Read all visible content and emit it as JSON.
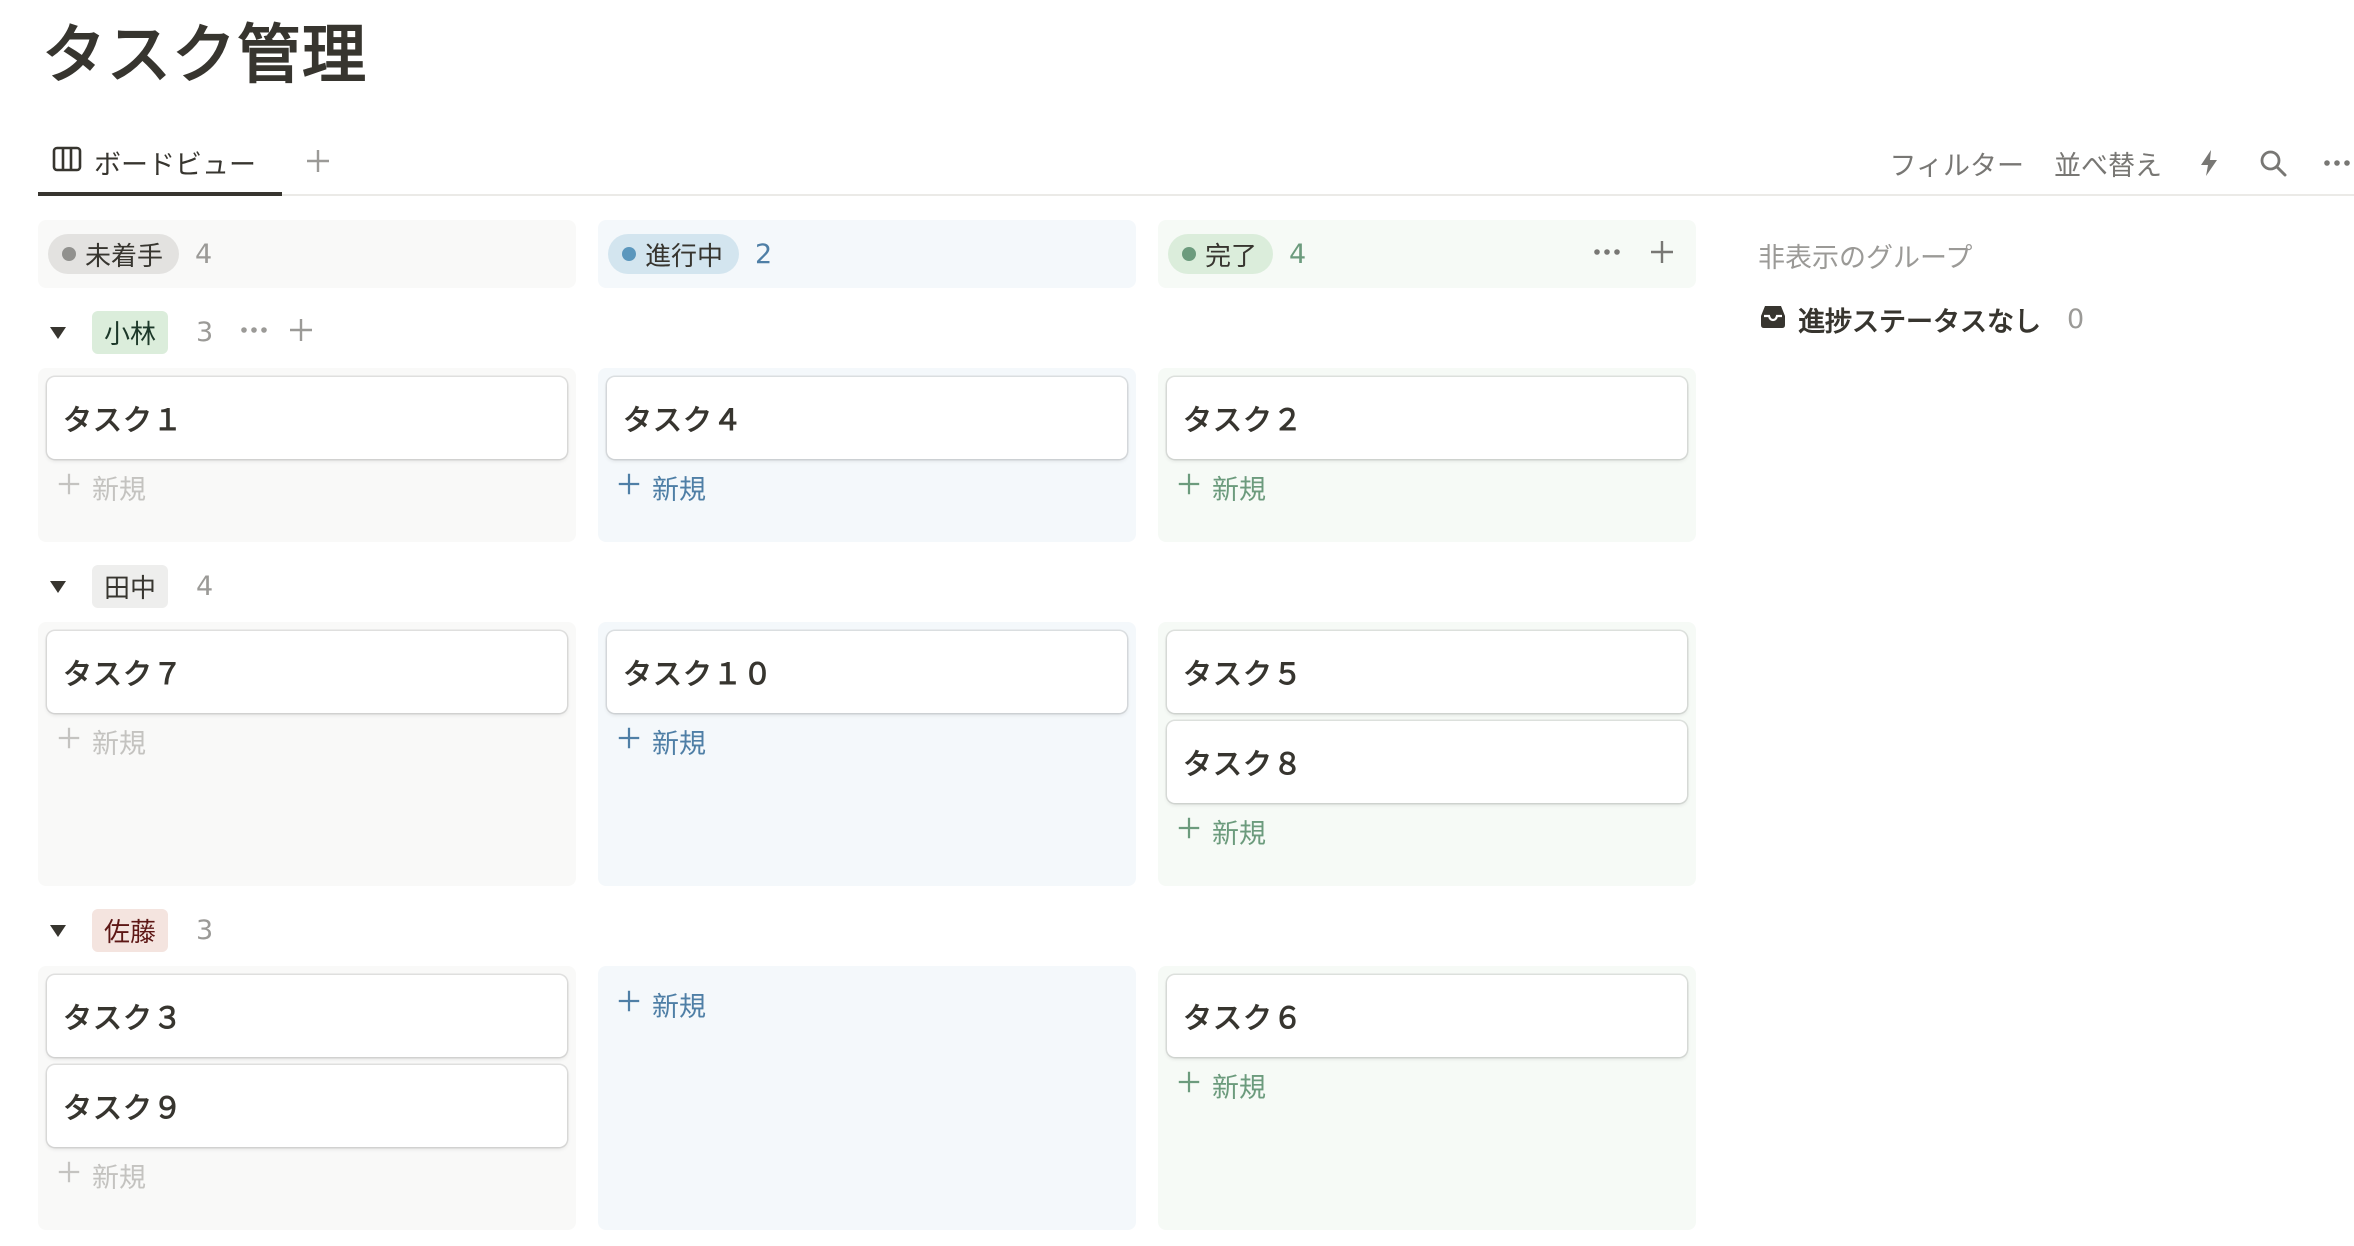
{
  "page": {
    "title": "タスク管理"
  },
  "views": {
    "active_tab": {
      "label": "ボードビュー",
      "icon": "board-icon"
    },
    "add_view_label": "+"
  },
  "toolbar": {
    "filter_label": "フィルター",
    "sort_label": "並べ替え",
    "automation_icon": "lightning-icon",
    "search_icon": "search-icon",
    "more_icon": "more-icon"
  },
  "columns": [
    {
      "label": "未着手",
      "count": "4",
      "bg": "#f9f9f8",
      "pill_bg": "#e3e2e0",
      "dot": "#91918e",
      "count_color": "#9b9a97"
    },
    {
      "label": "進行中",
      "count": "2",
      "bg": "#f4f8fb",
      "pill_bg": "#d3e5ef",
      "dot": "#5b97bd",
      "count_color": "#4f7fa6"
    },
    {
      "label": "完了",
      "count": "4",
      "bg": "#f6faf6",
      "pill_bg": "#dbeddb",
      "dot": "#6c9b7d",
      "count_color": "#6c9b7d"
    }
  ],
  "groups": [
    {
      "name": "小林",
      "count": "3",
      "tag_bg": "#dbeddb",
      "tag_color": "#1c3829",
      "cells": [
        {
          "cards": [
            "タスク１"
          ]
        },
        {
          "cards": [
            "タスク４"
          ]
        },
        {
          "cards": [
            "タスク２"
          ]
        }
      ]
    },
    {
      "name": "田中",
      "count": "4",
      "tag_bg": "#eeeeed",
      "tag_color": "#37352f",
      "cells": [
        {
          "cards": [
            "タスク７"
          ]
        },
        {
          "cards": [
            "タスク１０"
          ]
        },
        {
          "cards": [
            "タスク５",
            "タスク８"
          ]
        }
      ]
    },
    {
      "name": "佐藤",
      "count": "3",
      "tag_bg": "#f4e4df",
      "tag_color": "#5d1715",
      "cells": [
        {
          "cards": [
            "タスク３",
            "タスク９"
          ]
        },
        {
          "cards": []
        },
        {
          "cards": [
            "タスク６"
          ]
        }
      ]
    }
  ],
  "new_label": "新規",
  "new_colors": [
    "#c4c3c0",
    "#4f7fa6",
    "#6c9b7d"
  ],
  "hidden_groups": {
    "title": "非表示のグループ",
    "items": [
      {
        "label": "進捗ステータスなし",
        "count": "0",
        "icon": "inbox-icon"
      }
    ]
  }
}
